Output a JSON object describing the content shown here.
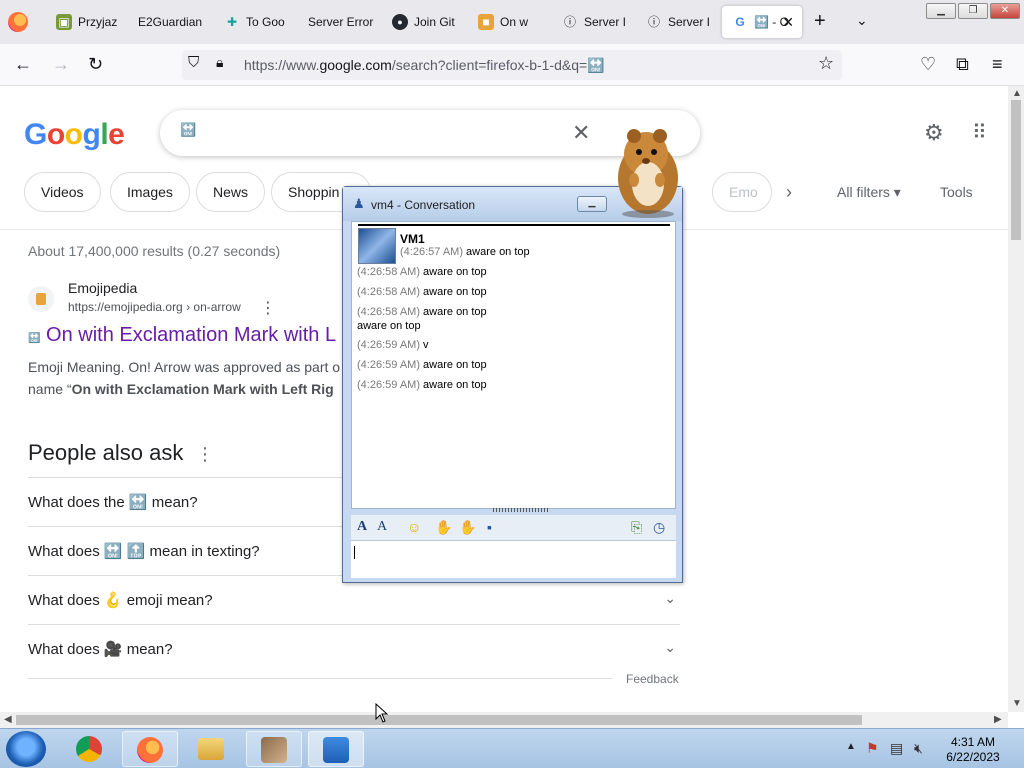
{
  "browser": {
    "tabs": [
      {
        "label": "Przyjaz",
        "icon": "bookmark-icon"
      },
      {
        "label": "E2Guardian",
        "icon": ""
      },
      {
        "label": "To Goo",
        "icon": "puzzle-icon"
      },
      {
        "label": "Server Error",
        "icon": ""
      },
      {
        "label": "Join Git",
        "icon": "github-icon"
      },
      {
        "label": "On w",
        "icon": "emojipedia-icon"
      },
      {
        "label": "Server I",
        "icon": "info-icon"
      },
      {
        "label": "Server I",
        "icon": "info-icon"
      },
      {
        "label": "🔛 - O",
        "icon": "google-icon",
        "active": true
      }
    ],
    "url_prefix": "https://www.",
    "url_domain": "google.com",
    "url_rest": "/search?client=firefox-b-1-d&q=🔛"
  },
  "google": {
    "logo": "Google",
    "query": "🔛",
    "chips": [
      "Videos",
      "Images",
      "News",
      "Shoppin",
      "Emo"
    ],
    "all_filters": "All filters",
    "tools": "Tools",
    "stats": "About 17,400,000 results (0.27 seconds)",
    "result": {
      "site": "Emojipedia",
      "url": "https://emojipedia.org › on-arrow",
      "emoji": "🔛",
      "title": "On with Exclamation Mark with L",
      "snippet_1": "Emoji Meaning. On! Arrow was approved as part o",
      "snippet_2_pre": "name “",
      "snippet_2_bold": "On with Exclamation Mark with Left Rig"
    },
    "paa_heading": "People also ask",
    "paa": [
      "What does the 🔛 mean?",
      "What does 🔛 🔝 mean in texting?",
      "What does 🪝 emoji mean?",
      "What does 🎥 mean?"
    ],
    "feedback": "Feedback"
  },
  "conversation": {
    "title": "vm4 - Conversation",
    "contact": "VM1",
    "first_time": "(4:26:57 AM)",
    "first_text": "aware on top",
    "messages": [
      {
        "time": "(4:26:58 AM)",
        "text": "aware on top"
      },
      {
        "time": "(4:26:58 AM)",
        "text": "aware on top"
      },
      {
        "time": "(4:26:58 AM)",
        "text": "aware on top"
      },
      {
        "time": "",
        "text": "aware on top"
      },
      {
        "time": "(4:26:59 AM)",
        "text": "v"
      },
      {
        "time": "(4:26:59 AM)",
        "text": "aware on top"
      },
      {
        "time": "(4:26:59 AM)",
        "text": "aware on top"
      }
    ]
  },
  "taskbar": {
    "time": "4:31 AM",
    "date": "6/22/2023"
  }
}
